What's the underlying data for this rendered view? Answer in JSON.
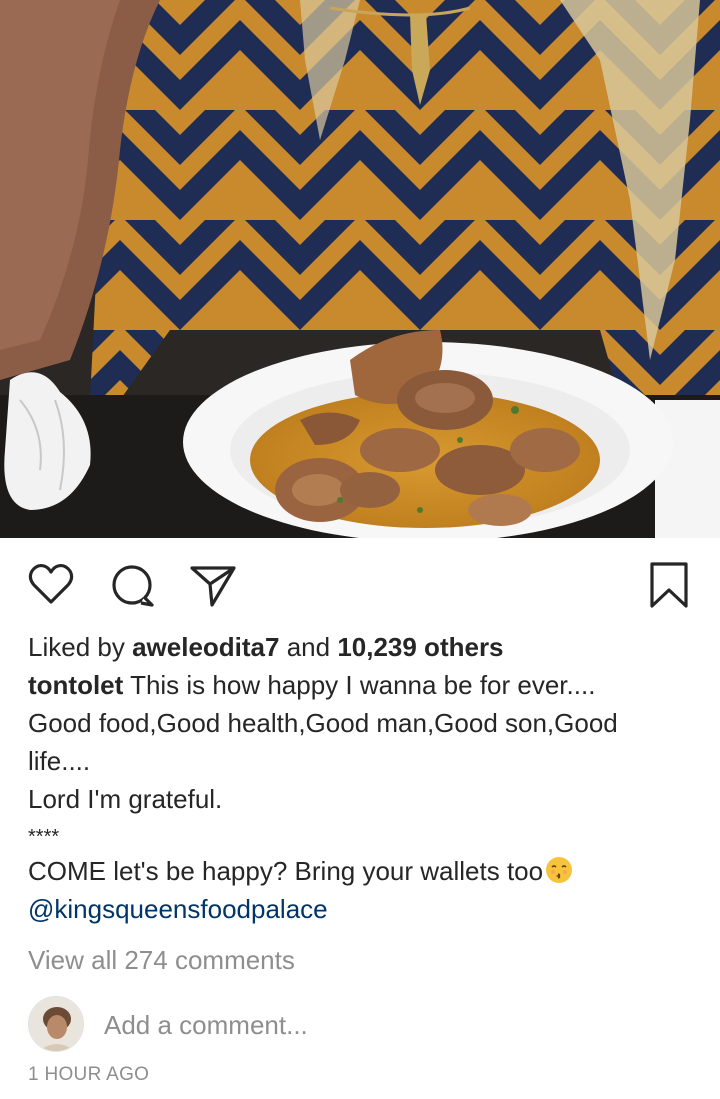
{
  "post": {
    "photo_alt": "Woman in a chevron-patterned blouse behind a white plate of pepper soup with assorted meat",
    "actions": {
      "like_icon": "heart-icon",
      "comment_icon": "comment-icon",
      "share_icon": "send-icon",
      "save_icon": "bookmark-icon"
    },
    "likes": {
      "prefix": "Liked by ",
      "user": "aweleodita7",
      "middle": " and ",
      "count": "10,239 others"
    },
    "caption": {
      "username": "tontolet",
      "line1": " This is how happy I wanna be for ever....",
      "line2": "Good food,Good health,Good man,Good son,Good",
      "line3": "life....",
      "line4": "Lord I'm grateful.",
      "stars": "****",
      "line5": "COME let's be happy? Bring your wallets too",
      "emoji": "kissing-face-emoji",
      "mention": "@kingsqueensfoodpalace"
    },
    "view_all_comments": "View all 274 comments",
    "comment_input": {
      "placeholder": "Add a comment..."
    },
    "timestamp": "1 HOUR AGO"
  },
  "colors": {
    "text": "#262626",
    "muted": "#8e8e8e",
    "mention": "#003569",
    "background": "#ffffff"
  }
}
